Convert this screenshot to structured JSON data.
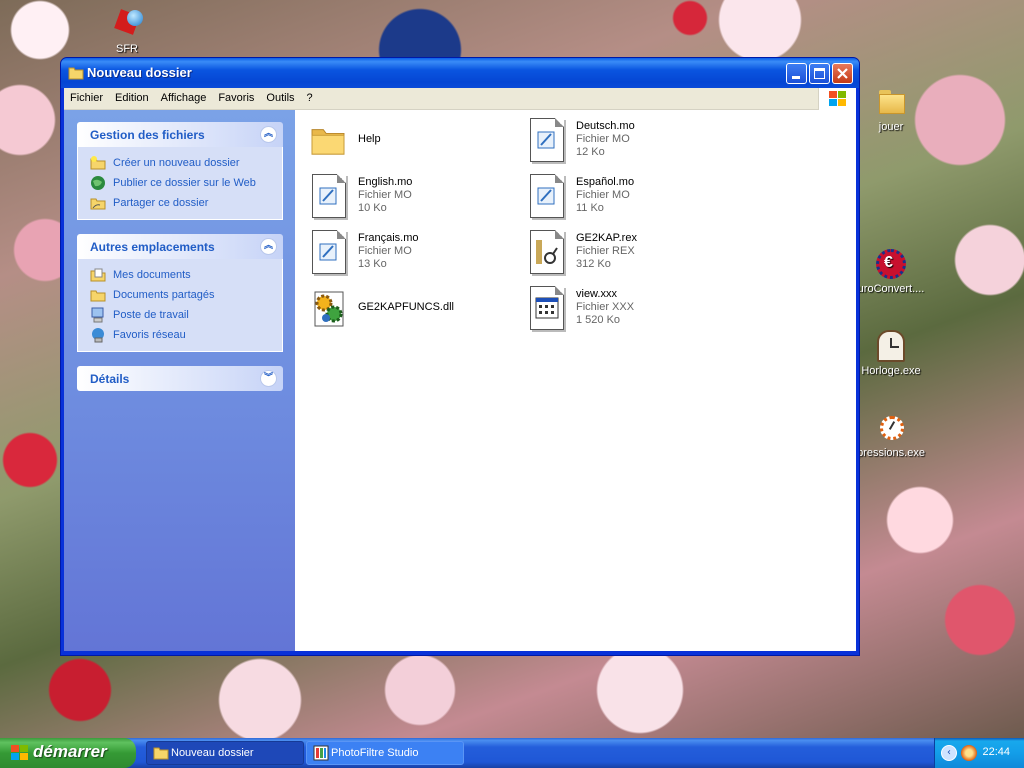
{
  "desktop_icons": {
    "sfr": "SFR",
    "jouer": "jouer",
    "euroconvert": "uroConvert....",
    "horloge": "Horloge.exe",
    "pressions": "pressions.exe"
  },
  "window": {
    "title": "Nouveau dossier",
    "menu": [
      "Fichier",
      "Edition",
      "Affichage",
      "Favoris",
      "Outils",
      "?"
    ]
  },
  "taskpane": {
    "file_tasks": {
      "title": "Gestion des fichiers",
      "links": [
        "Créer un nouveau dossier",
        "Publier ce dossier sur le Web",
        "Partager ce dossier"
      ]
    },
    "other_places": {
      "title": "Autres emplacements",
      "links": [
        "Mes documents",
        "Documents partagés",
        "Poste de travail",
        "Favoris réseau"
      ]
    },
    "details": {
      "title": "Détails"
    }
  },
  "files": [
    {
      "name": "Help",
      "type": "",
      "size": "",
      "icon": "folder-icon"
    },
    {
      "name": "Deutsch.mo",
      "type": "Fichier MO",
      "size": "12 Ko",
      "icon": "mo-file-icon"
    },
    {
      "name": "English.mo",
      "type": "Fichier MO",
      "size": "10 Ko",
      "icon": "mo-file-icon"
    },
    {
      "name": "Español.mo",
      "type": "Fichier MO",
      "size": "11 Ko",
      "icon": "mo-file-icon"
    },
    {
      "name": "Français.mo",
      "type": "Fichier MO",
      "size": "13 Ko",
      "icon": "mo-file-icon"
    },
    {
      "name": "GE2KAP.rex",
      "type": "Fichier REX",
      "size": "312 Ko",
      "icon": "rex-file-icon"
    },
    {
      "name": "GE2KAPFUNCS.dll",
      "type": "",
      "size": "",
      "icon": "dll-gear-icon"
    },
    {
      "name": "view.xxx",
      "type": "Fichier XXX",
      "size": "1 520 Ko",
      "icon": "xxx-file-icon"
    }
  ],
  "taskbar": {
    "start_label": "démarrer",
    "items": [
      "Nouveau dossier",
      "PhotoFiltre Studio"
    ],
    "clock": "22:44"
  },
  "colors": {
    "window_frame": "#0831d9",
    "taskpane_link": "#215dc6",
    "start_green": "#359a35",
    "taskbar_blue": "#245edb"
  }
}
